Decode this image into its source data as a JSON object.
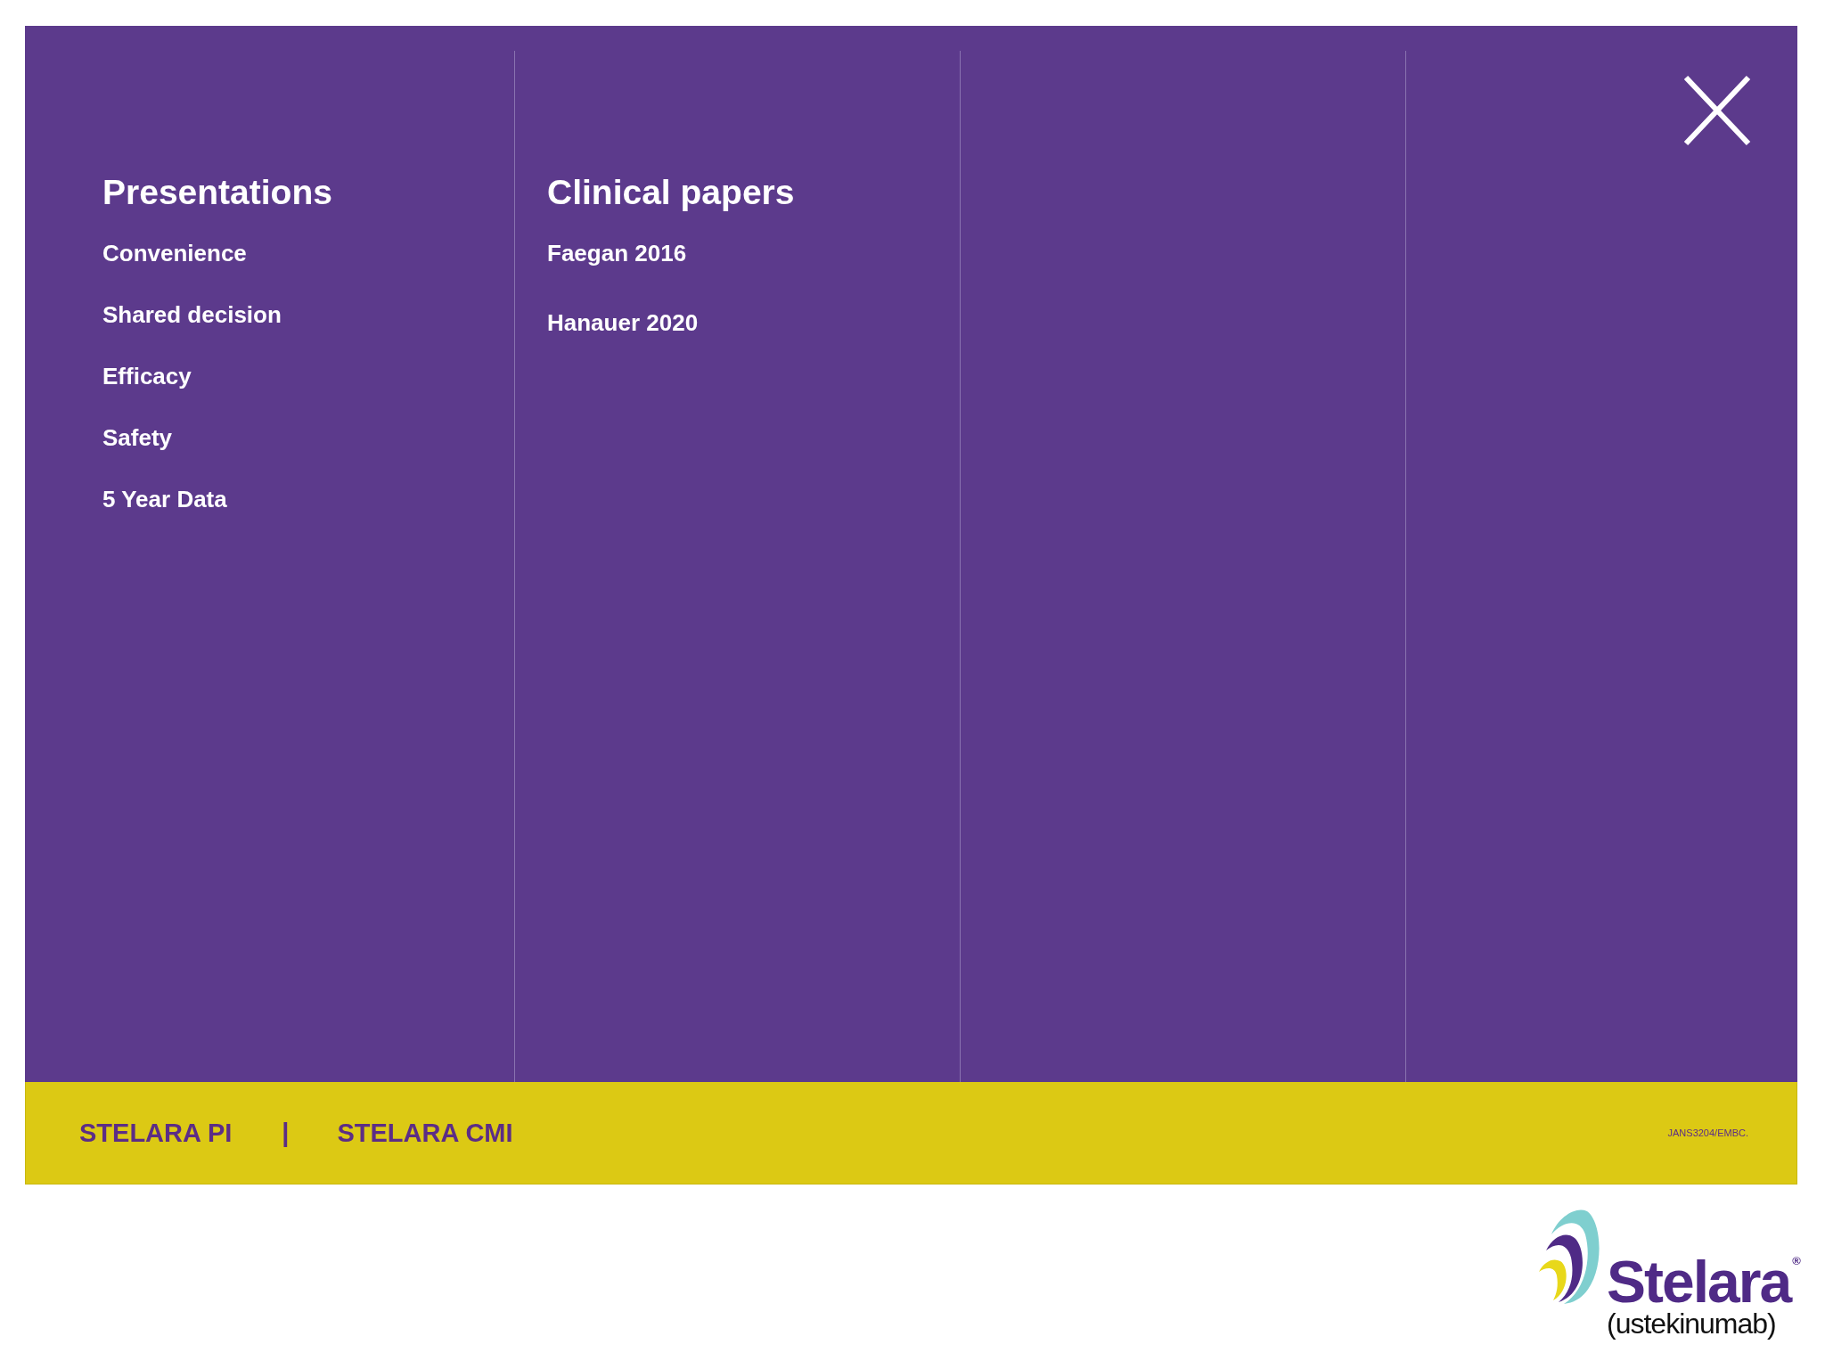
{
  "menu": {
    "columns": [
      {
        "heading": "Presentations",
        "items": [
          "Convenience",
          "Shared decision",
          "Efficacy",
          "Safety",
          "5 Year Data"
        ]
      },
      {
        "heading": "Clinical papers",
        "items": [
          "Faegan 2016",
          "Hanauer 2020"
        ]
      }
    ]
  },
  "footer": {
    "links": [
      {
        "label": "STELARA PI"
      },
      {
        "label": "STELARA CMI"
      }
    ],
    "separator": "|",
    "code": "JANS3204/EMBC."
  },
  "logo": {
    "name": "Stelara",
    "mark": "®",
    "subtitle": "(ustekinumab)"
  }
}
